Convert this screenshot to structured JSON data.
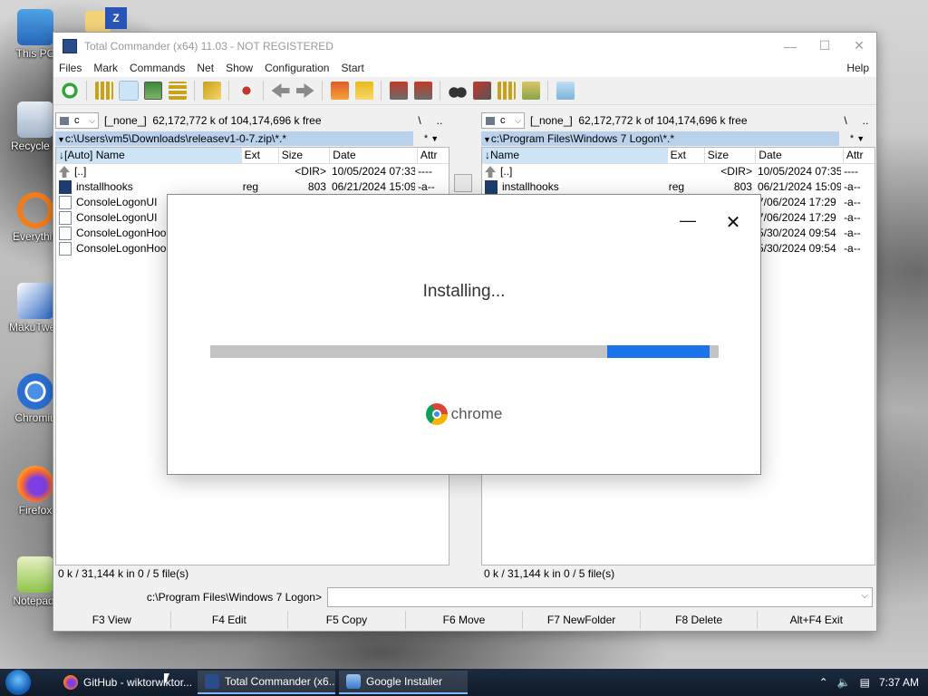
{
  "desktop": {
    "icons": [
      {
        "label": "This PC"
      },
      {
        "label": "Recycle B"
      },
      {
        "label": "Everythin"
      },
      {
        "label": "MakuTwea"
      },
      {
        "label": "Chromiu"
      },
      {
        "label": "Firefox"
      },
      {
        "label": "Notepad-"
      }
    ]
  },
  "tc": {
    "title": "Total Commander (x64) 11.03 - NOT REGISTERED",
    "menu": [
      "Files",
      "Mark",
      "Commands",
      "Net",
      "Show",
      "Configuration",
      "Start"
    ],
    "help": "Help",
    "left": {
      "drive": "c",
      "drive_info": "[_none_]  62,172,772 k of 104,174,696 k free",
      "path": "c:\\Users\\vm5\\Downloads\\releasev1-0-7.zip\\*.*",
      "root_btn": "\\",
      "up_btn": "..",
      "filter": "*",
      "headers": {
        "name": "[Auto] Name",
        "ext": "Ext",
        "size": "Size",
        "date": "Date",
        "attr": "Attr"
      },
      "rows": [
        {
          "name": "[..]",
          "ext": "",
          "size": "<DIR>",
          "date": "10/05/2024 07:33",
          "attr": "----"
        },
        {
          "name": "installhooks",
          "ext": "reg",
          "size": "803",
          "date": "06/21/2024 15:09",
          "attr": "-a--"
        },
        {
          "name": "ConsoleLogonUI",
          "ext": "",
          "size": "",
          "date": "",
          "attr": ""
        },
        {
          "name": "ConsoleLogonUI",
          "ext": "",
          "size": "",
          "date": "",
          "attr": ""
        },
        {
          "name": "ConsoleLogonHook",
          "ext": "",
          "size": "",
          "date": "",
          "attr": ""
        },
        {
          "name": "ConsoleLogonHook",
          "ext": "",
          "size": "",
          "date": "",
          "attr": ""
        }
      ],
      "status": "0 k / 31,144 k in 0 / 5 file(s)"
    },
    "right": {
      "drive": "c",
      "drive_info": "[_none_]  62,172,772 k of 104,174,696 k free",
      "path": "c:\\Program Files\\Windows 7 Logon\\*.*",
      "root_btn": "\\",
      "up_btn": "..",
      "filter": "*",
      "headers": {
        "name": "Name",
        "ext": "Ext",
        "size": "Size",
        "date": "Date",
        "attr": "Attr"
      },
      "rows": [
        {
          "name": "[..]",
          "ext": "",
          "size": "<DIR>",
          "date": "10/05/2024 07:35",
          "attr": "----"
        },
        {
          "name": "installhooks",
          "ext": "reg",
          "size": "803",
          "date": "06/21/2024 15:09",
          "attr": "-a--"
        },
        {
          "name": "",
          "ext": "",
          "size": "",
          "date": "7/06/2024 17:29",
          "attr": "-a--"
        },
        {
          "name": "",
          "ext": "",
          "size": "",
          "date": "7/06/2024 17:29",
          "attr": "-a--"
        },
        {
          "name": "",
          "ext": "",
          "size": "",
          "date": "5/30/2024 09:54",
          "attr": "-a--"
        },
        {
          "name": "",
          "ext": "",
          "size": "",
          "date": "5/30/2024 09:54",
          "attr": "-a--"
        }
      ],
      "status": "0 k / 31,144 k in 0 / 5 file(s)"
    },
    "cmd_prompt": "c:\\Program Files\\Windows 7 Logon>",
    "cmd_value": "",
    "fkeys": [
      "F3 View",
      "F4 Edit",
      "F5 Copy",
      "F6 Move",
      "F7 NewFolder",
      "F8 Delete",
      "Alt+F4 Exit"
    ]
  },
  "installer": {
    "status": "Installing...",
    "progress_segment": {
      "start": 0.78,
      "end": 0.982
    },
    "brand": "chrome",
    "accent": "#1a73e8"
  },
  "taskbar": {
    "tasks": [
      {
        "label": "GitHub - wiktorwiktor..."
      },
      {
        "label": "Total Commander (x6..."
      },
      {
        "label": "Google Installer"
      }
    ],
    "clock": "7:37 AM"
  }
}
